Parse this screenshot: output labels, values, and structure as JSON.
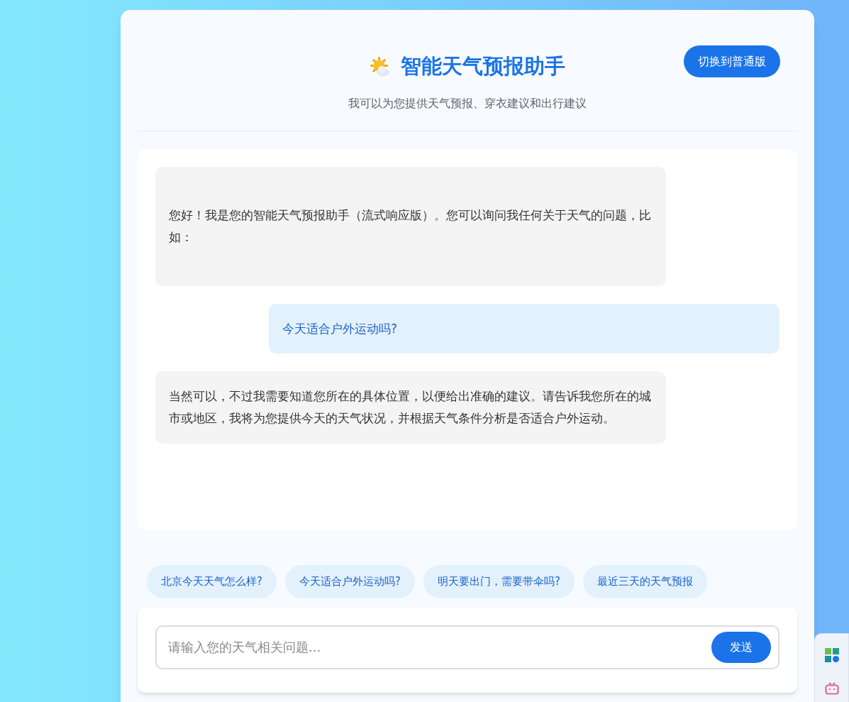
{
  "header": {
    "title": "智能天气预报助手",
    "subtitle": "我可以为您提供天气预报、穿衣建议和出行建议",
    "switch_button": "切换到普通版"
  },
  "messages": [
    {
      "kind": "bot",
      "text": "您好！我是您的智能天气预报助手（流式响应版）。您可以询问我任何关于天气的问题，比如："
    },
    {
      "kind": "user",
      "text": "今天适合户外运动吗?"
    },
    {
      "kind": "bot",
      "text": "当然可以，不过我需要知道您所在的具体位置，以便给出准确的建议。请告诉我您所在的城市或地区，我将为您提供今天的天气状况，并根据天气条件分析是否适合户外运动。"
    }
  ],
  "suggestions": [
    "北京今天天气怎么样?",
    "今天适合户外运动吗?",
    "明天要出门，需要带伞吗?",
    "最近三天的天气预报"
  ],
  "input": {
    "placeholder": "请输入您的天气相关问题...",
    "send_button": "发送"
  }
}
